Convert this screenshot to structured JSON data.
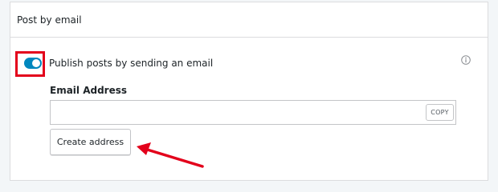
{
  "section": {
    "title": "Post by email"
  },
  "toggle": {
    "label": "Publish posts by sending an email",
    "state": "on",
    "color": "#0087be"
  },
  "email": {
    "label": "Email Address",
    "value": "",
    "copy_label": "COPY"
  },
  "actions": {
    "create_label": "Create address"
  },
  "annotation": {
    "color": "#e3001b"
  },
  "icons": {
    "info": "info-icon"
  }
}
